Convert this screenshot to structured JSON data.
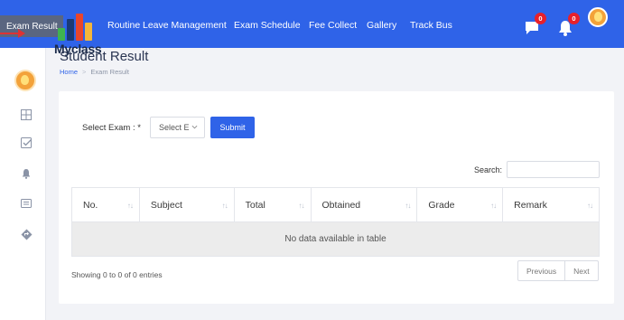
{
  "topbar": {
    "tooltip": "Exam Result",
    "nav_items": [
      "Routine",
      "Leave Management",
      "Exam Schedule",
      "Fee Collect",
      "Gallery",
      "Track Bus"
    ],
    "message_badge": "0",
    "notification_badge": "0",
    "brand": "Myclass"
  },
  "page": {
    "title": "Student Result",
    "breadcrumb": {
      "home": "Home",
      "current": "Exam Result"
    }
  },
  "form": {
    "exam_label": "Select Exam : *",
    "exam_select_value": "Select E",
    "submit_label": "Submit"
  },
  "table": {
    "search_label": "Search:",
    "columns": [
      "No.",
      "Subject",
      "Total",
      "Obtained",
      "Grade",
      "Remark"
    ],
    "sort_glyph": "↑↓",
    "empty_message": "No data available in table",
    "info": "Showing 0 to 0 of 0 entries",
    "pagination": {
      "previous": "Previous",
      "next": "Next"
    }
  },
  "colors": {
    "accent": "#2f63e8",
    "badge": "#e8202a",
    "avatar": "#f3a23a"
  },
  "icons": {
    "sidebar": [
      "grid-icon",
      "checklist-icon",
      "bell-icon",
      "message-icon",
      "diamond-arrow-icon"
    ],
    "topbar": [
      "chat-icon",
      "bell-icon",
      "avatar"
    ]
  }
}
